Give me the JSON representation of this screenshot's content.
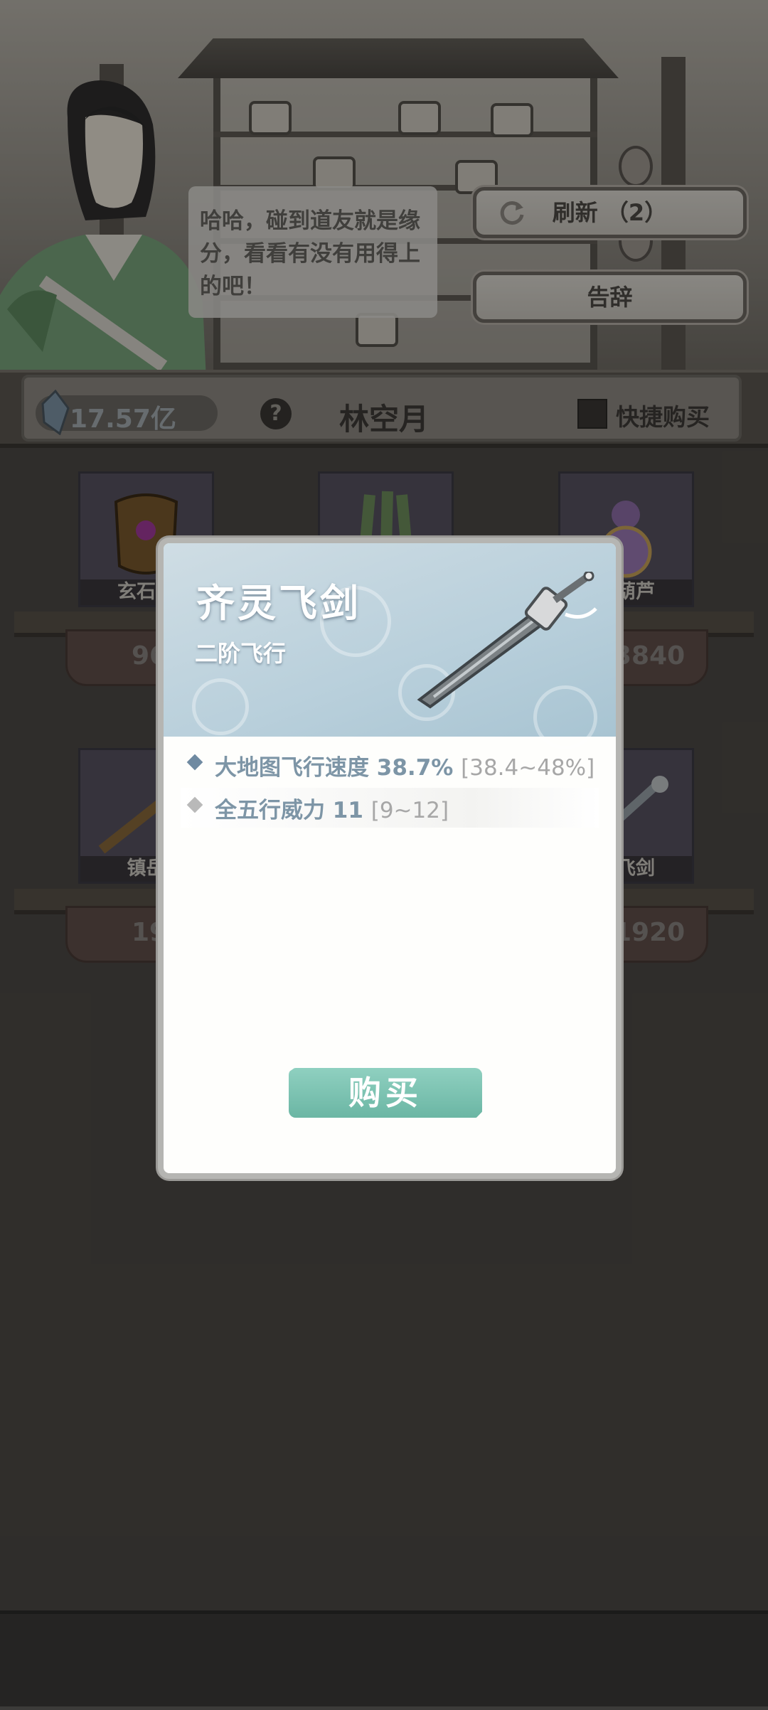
{
  "npc": {
    "dialogue": "哈哈，碰到道友就是缘分，看看有没有用得上的吧！"
  },
  "buttons": {
    "refresh": "刷新 （2）",
    "farewell": "告辞"
  },
  "topbar": {
    "currency": "17.57亿",
    "help": "?",
    "shop_name": "林空月",
    "quick_buy": "快捷购买",
    "quick_buy_checked": false
  },
  "items": [
    {
      "name": "玄石塔",
      "price": "96",
      "icon": "armor-icon"
    },
    {
      "name": "",
      "price": "",
      "icon": "bamboo-icon"
    },
    {
      "name": "藏葫芦",
      "price": "3840",
      "icon": "gourd-icon"
    },
    {
      "name": "镇岳",
      "price": "19",
      "icon": "staff-icon"
    },
    {
      "name": "",
      "price": "",
      "icon": "sword-icon"
    },
    {
      "name": "灵飞剑",
      "price": "1920",
      "icon": "sword-icon"
    }
  ],
  "dialog": {
    "title": "齐灵飞剑",
    "subtitle": "二阶飞行",
    "stats": [
      {
        "text": "大地图飞行速度 38.7%",
        "range": "[38.4~48%]",
        "bullet_color": "#6f8aa1"
      },
      {
        "text": "全五行威力 11",
        "range": "[9~12]",
        "bullet_color": "#b9b9b9"
      }
    ],
    "buy_label": "购买"
  }
}
